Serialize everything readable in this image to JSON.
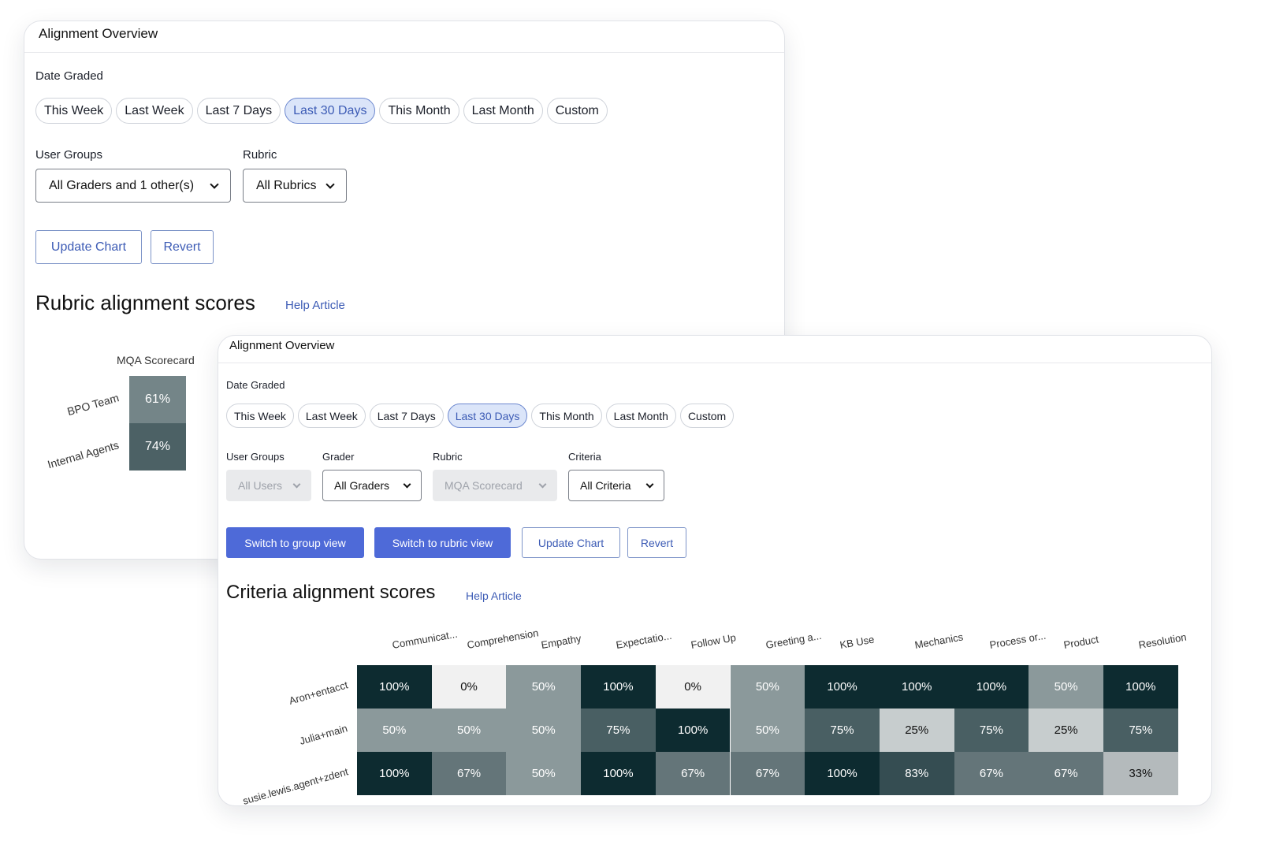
{
  "back_panel": {
    "title": "Alignment Overview",
    "date_label": "Date Graded",
    "date_options": [
      "This Week",
      "Last Week",
      "Last 7 Days",
      "Last 30 Days",
      "This Month",
      "Last Month",
      "Custom"
    ],
    "date_selected": "Last 30 Days",
    "user_groups_label": "User Groups",
    "user_groups_value": "All Graders and 1 other(s)",
    "rubric_label": "Rubric",
    "rubric_value": "All Rubrics",
    "update_label": "Update Chart",
    "revert_label": "Revert",
    "section_title": "Rubric alignment scores",
    "help_link": "Help Article"
  },
  "front_panel": {
    "title": "Alignment Overview",
    "date_label": "Date Graded",
    "date_options": [
      "This Week",
      "Last Week",
      "Last 7 Days",
      "Last 30 Days",
      "This Month",
      "Last Month",
      "Custom"
    ],
    "date_selected": "Last 30 Days",
    "filters": [
      {
        "label": "User Groups",
        "value": "All Users",
        "disabled": true
      },
      {
        "label": "Grader",
        "value": "All Graders",
        "disabled": false
      },
      {
        "label": "Rubric",
        "value": "MQA Scorecard",
        "disabled": true
      },
      {
        "label": "Criteria",
        "value": "All Criteria",
        "disabled": false
      }
    ],
    "group_view_label": "Switch to group view",
    "rubric_view_label": "Switch to rubric view",
    "update_label": "Update Chart",
    "revert_label": "Revert",
    "section_title": "Criteria alignment scores",
    "help_link": "Help Article"
  },
  "chart_data": [
    {
      "type": "heatmap",
      "columns": [
        "MQA Scorecard"
      ],
      "rows": [
        "BPO Team",
        "Internal Agents"
      ],
      "values": [
        [
          61
        ],
        [
          74
        ]
      ],
      "value_labels": [
        [
          "61%"
        ],
        [
          "74%"
        ]
      ],
      "unit": "%"
    },
    {
      "type": "heatmap",
      "columns": [
        "Communicat...",
        "Comprehension",
        "Empathy",
        "Expectatio...",
        "Follow Up",
        "Greeting a...",
        "KB Use",
        "Mechanics",
        "Process or...",
        "Product",
        "Resolution"
      ],
      "rows": [
        "Aron+entacct",
        "Julia+main",
        "susie.lewis.agent+zdent"
      ],
      "values": [
        [
          100,
          0,
          50,
          100,
          0,
          50,
          100,
          100,
          100,
          50,
          100
        ],
        [
          50,
          50,
          50,
          75,
          100,
          50,
          75,
          25,
          75,
          25,
          75
        ],
        [
          100,
          67,
          50,
          100,
          67,
          67,
          100,
          83,
          67,
          67,
          33
        ]
      ],
      "value_labels": [
        [
          "100%",
          "0%",
          "50%",
          "100%",
          "0%",
          "50%",
          "100%",
          "100%",
          "100%",
          "50%",
          "100%"
        ],
        [
          "50%",
          "50%",
          "50%",
          "75%",
          "100%",
          "50%",
          "75%",
          "25%",
          "75%",
          "25%",
          "75%"
        ],
        [
          "100%",
          "67%",
          "50%",
          "100%",
          "67%",
          "67%",
          "100%",
          "83%",
          "67%",
          "67%",
          "33%"
        ]
      ],
      "unit": "%"
    }
  ]
}
